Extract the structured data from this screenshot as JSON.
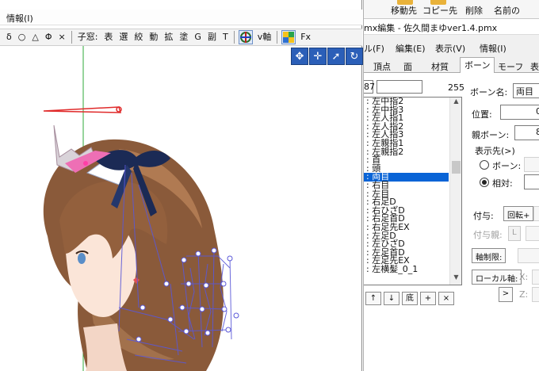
{
  "viewer": {
    "menu_info": "情報(I)",
    "toolbar": {
      "sym1": "δ",
      "sym2": "○",
      "sym3": "△",
      "sym4": "Φ",
      "sym5": "×",
      "child_window": "子窓:",
      "items": [
        "表",
        "選",
        "絞",
        "動",
        "拡",
        "塗",
        "G",
        "副",
        "T"
      ],
      "vaxis": "v軸",
      "fx": "Fx"
    },
    "gizmos": [
      "move-both-icon",
      "move-icon",
      "rotate-arrow-icon",
      "rotate-icon"
    ]
  },
  "editor": {
    "background_toolbar": {
      "move_dest": "移動先",
      "copy_dest": "コピー先",
      "delete": "削除",
      "name_of": "名前の"
    },
    "title": "mx編集 - 佐久間まゆver1.4.pmx",
    "menu": [
      "ル(F)",
      "編集(E)",
      "表示(V)",
      "情報(I)"
    ],
    "tabs": [
      "頂点",
      "面",
      "材質",
      "ボーン",
      "モーフ",
      "表示"
    ],
    "active_tab": "ボーン",
    "bone_index": "87",
    "bone_name_input": "",
    "bone_count": "255",
    "bone_list": [
      ": 左中指2",
      ": 左中指3",
      ": 左人指1",
      ": 左人指2",
      ": 左人指3",
      ": 左親指1",
      ": 左親指2",
      ": 首",
      ": 頭",
      ": 両目",
      ": 右目",
      ": 左目",
      ": 右足D",
      ": 右ひざD",
      ": 右足首D",
      ": 右足先EX",
      ": 左足D",
      ": 左ひざD",
      ": 左足首D",
      ": 左足先EX",
      ": 左横髪_0_1"
    ],
    "selected_bone": ": 両目",
    "list_buttons": [
      "↑",
      "↓",
      "底",
      "+",
      "×"
    ],
    "props": {
      "bone_name_label": "ボーン名:",
      "bone_name_value": "両目",
      "position_label": "位置:",
      "position_x": "0",
      "parent_label": "親ボーン:",
      "parent_value": "8",
      "display_to_label": "表示先(>)",
      "radio_bone": "ボーン:",
      "radio_relative": "相対:",
      "grant_label": "付与:",
      "grant_rotate": "回転+",
      "grant_parent_label": "付与親:",
      "grant_parent_btn": "L",
      "fixed_axis": "軸制限:",
      "local_axis": "ローカル軸:",
      "axis_x": "X:",
      "axis_z": "Z:",
      "arrow_btn": ">"
    }
  }
}
